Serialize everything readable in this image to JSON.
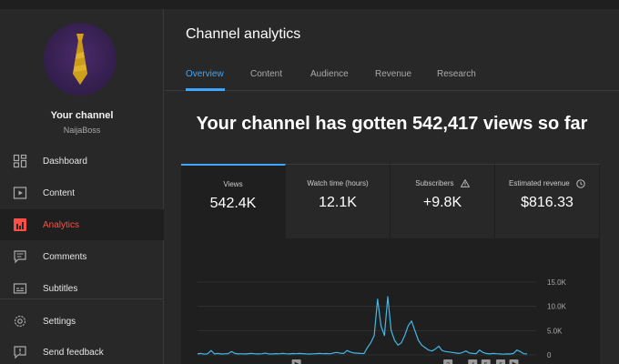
{
  "sidebar": {
    "channel_name": "Your channel",
    "channel_handle": "NaijaBoss",
    "items": [
      {
        "label": "Dashboard",
        "icon": "dashboard-icon",
        "active": false
      },
      {
        "label": "Content",
        "icon": "content-icon",
        "active": false
      },
      {
        "label": "Analytics",
        "icon": "analytics-icon",
        "active": true
      },
      {
        "label": "Comments",
        "icon": "comments-icon",
        "active": false
      },
      {
        "label": "Subtitles",
        "icon": "subtitles-icon",
        "active": false
      },
      {
        "label": "Settings",
        "icon": "settings-icon",
        "active": false
      },
      {
        "label": "Send feedback",
        "icon": "feedback-icon",
        "active": false
      }
    ]
  },
  "header": {
    "title": "Channel analytics"
  },
  "tabs": [
    {
      "label": "Overview",
      "active": true
    },
    {
      "label": "Content",
      "active": false
    },
    {
      "label": "Audience",
      "active": false
    },
    {
      "label": "Revenue",
      "active": false
    },
    {
      "label": "Research",
      "active": false
    }
  ],
  "headline": "Your channel has gotten 542,417 views so far",
  "metrics": [
    {
      "label": "Views",
      "value": "542.4K",
      "active": true,
      "icon": ""
    },
    {
      "label": "Watch time (hours)",
      "value": "12.1K",
      "active": false,
      "icon": ""
    },
    {
      "label": "Subscribers",
      "value": "+9.8K",
      "active": false,
      "icon": "warning-icon"
    },
    {
      "label": "Estimated revenue",
      "value": "$816.33",
      "active": false,
      "icon": "clock-icon"
    }
  ],
  "colors": {
    "accent_blue": "#3ea6ff",
    "active_red": "#ff4e45",
    "background": "#282828",
    "chart_line": "#41b8e6"
  },
  "chart_data": {
    "type": "line",
    "series": [
      {
        "values": [
          200,
          300,
          150,
          250,
          900,
          200,
          300,
          180,
          220,
          260,
          700,
          300,
          200,
          240,
          180,
          260,
          300,
          220,
          200,
          250,
          350,
          200,
          180,
          260,
          220,
          300,
          250,
          200,
          280,
          240,
          300,
          260,
          200,
          180,
          220,
          260,
          300,
          240,
          280,
          220,
          400,
          500,
          350,
          300,
          900,
          600,
          400,
          350,
          300,
          280,
          1500,
          2500,
          4000,
          11500,
          6000,
          4000,
          12000,
          5000,
          3000,
          2000,
          2500,
          4000,
          6000,
          7000,
          5000,
          3000,
          2000,
          1500,
          1000,
          800,
          1200,
          1800,
          900,
          700,
          600,
          500,
          400,
          300,
          500,
          800,
          400,
          300,
          250,
          1000,
          500,
          300,
          200,
          300,
          250,
          200,
          150,
          200,
          180,
          300,
          1000,
          700,
          250,
          200
        ]
      }
    ],
    "ylim": [
      0,
      15000
    ],
    "y_ticks": [
      "0",
      "5.0K",
      "10.0K",
      "15.0K"
    ],
    "y_tick_values": [
      0,
      5000,
      10000,
      15000
    ],
    "x_marker_labels": [
      "2",
      "4",
      "5",
      "6"
    ],
    "x_marker_positions": [
      0.76,
      0.835,
      0.875,
      0.92
    ]
  }
}
